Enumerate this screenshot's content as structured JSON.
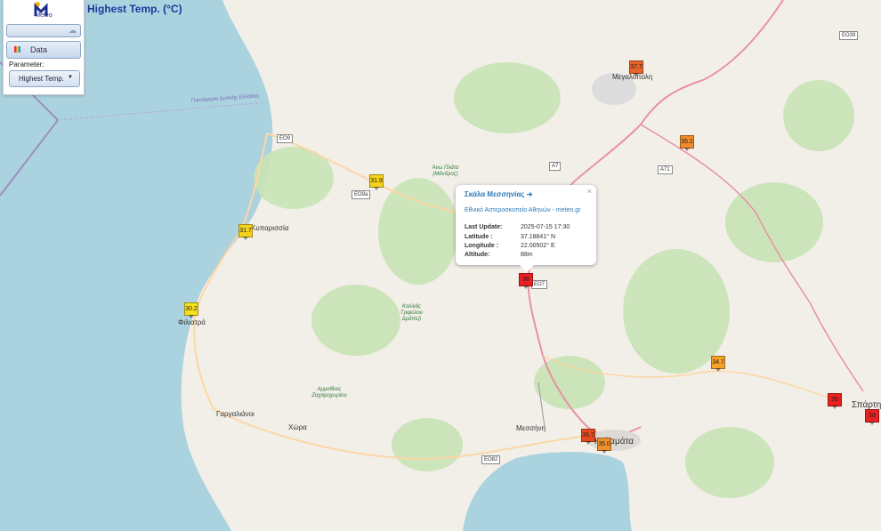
{
  "app": {
    "logo_text": "Meteo",
    "map_title": "Highest Temp. (°C)"
  },
  "controls": {
    "data_label": "Data",
    "parameter_label": "Parameter:",
    "parameter_value": "Highest Temp."
  },
  "places": [
    {
      "name": "Μεγαλόπολη"
    },
    {
      "name": "Κυπαρισσία"
    },
    {
      "name": "Φιλιατρά"
    },
    {
      "name": "Γαργαλιάνοι"
    },
    {
      "name": "Χώρα"
    },
    {
      "name": "Μεσσήνη"
    },
    {
      "name": "Καλαμάτα"
    },
    {
      "name": "Σπάρτη"
    }
  ],
  "nature_labels": [
    "Άνω Πλάτα (Μάνδρος)",
    "Καλλιάς Τριφύλου Δράπεζι",
    "Αμμοθίνες Ζαχαροχωρίου"
  ],
  "roads": [
    "EO9",
    "EO9a",
    "A7",
    "A71",
    "EO39",
    "EO82",
    "EO7"
  ],
  "boundary_label": "Πικνόφοριο Δυτικής Ελλάδας",
  "markers": [
    {
      "value": "37.7",
      "color": "#e8632a"
    },
    {
      "value": "35.1",
      "color": "#f08a2a"
    },
    {
      "value": "31.9",
      "color": "#f6d21a"
    },
    {
      "value": "31.7",
      "color": "#f6d21a"
    },
    {
      "value": "30.2",
      "color": "#f6e01a"
    },
    {
      "value": "38",
      "color": "#e82020"
    },
    {
      "value": "34.7",
      "color": "#f6a22a"
    },
    {
      "value": "36.7",
      "color": "#e84a20"
    },
    {
      "value": "35.0",
      "color": "#f0902a"
    },
    {
      "value": "39",
      "color": "#e82020"
    },
    {
      "value": "38",
      "color": "#e82020"
    }
  ],
  "popup": {
    "title": "Σκάλα Μεσσηνίας",
    "source": "Εθνικό Αστεροσκοπείο Αθηνών - meteo.gr",
    "last_update_label": "Last Update:",
    "last_update": "2025-07-15 17:30",
    "lat_label": "Latitude :",
    "lat": "37.18841° N",
    "lon_label": "Longitude :",
    "lon": "22.00502° E",
    "alt_label": "Altitude:",
    "alt": "88m",
    "close": "×"
  },
  "colors": {
    "sea": "#aad3df",
    "land": "#f2efe9",
    "forest": "#c8e3b5",
    "motorway": "#e892a2",
    "primary": "#fcd6a4"
  }
}
